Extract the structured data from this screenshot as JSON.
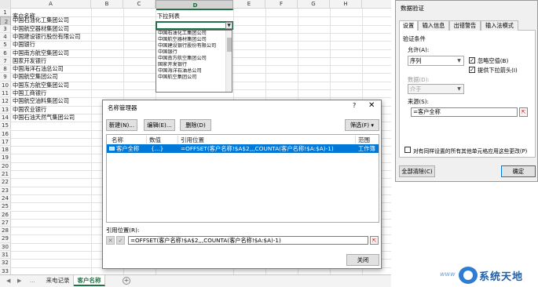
{
  "spreadsheet": {
    "columns": [
      "A",
      "B",
      "C",
      "D",
      "E",
      "F",
      "G",
      "H"
    ],
    "selected_column": "D",
    "rows": [
      "1",
      "2",
      "3",
      "4",
      "5",
      "6",
      "7",
      "8",
      "9",
      "10",
      "11",
      "12",
      "13",
      "14",
      "15",
      "16",
      "17",
      "18",
      "19",
      "20",
      "21",
      "22",
      "23",
      "24",
      "25",
      "26",
      "27",
      "28",
      "29",
      "30",
      "31",
      "32",
      "33"
    ],
    "selected_row": "2",
    "a_header": "客户名称",
    "a_values": [
      "中国石油化工集团公司",
      "中国航空器材集团公司",
      "中国建设银行股份有限公司",
      "中国银行",
      "中国南方航空集团公司",
      "国家开发银行",
      "中国海洋石油总公司",
      "中国航空集团公司",
      "中国东方航空集团公司",
      "中国工商银行",
      "中国航空油料集团公司",
      "中国农业银行",
      "中国石油天然气集团公司"
    ],
    "d_header": "下拉列表",
    "dropdown_items": [
      "中国石油化工集团公司",
      "中国航空器材集团公司",
      "中国建设银行股份有限公司",
      "中国银行",
      "中国南方航空集团公司",
      "国家开发银行",
      "中国海洋石油总公司",
      "中国航空集团公司"
    ],
    "sheet_tabs": [
      "来电记录",
      "客户名称"
    ],
    "active_tab": "客户名称",
    "nav_prev": "◀",
    "nav_next": "▶",
    "nav_more": "...",
    "add_sheet": "+"
  },
  "name_manager": {
    "title": "名称管理器",
    "help": "?",
    "close": "✕",
    "buttons": {
      "new": "新建(N)...",
      "edit": "编辑(E)...",
      "delete": "删除(D)",
      "filter": "筛选(F) ▾"
    },
    "columns": {
      "name": "名称",
      "value": "数值",
      "refers_to": "引用位置",
      "scope": "范围"
    },
    "rows": [
      {
        "name": "客户全称",
        "value": "{...}",
        "refers_to": "=OFFSET(客户名称!$A$2,,,COUNTA(客户名称!$A:$A)-1)",
        "scope": "工作簿"
      }
    ],
    "ref_label": "引用位置(R):",
    "ref_cancel": "✕",
    "ref_confirm": "✓",
    "ref_value": "=OFFSET(客户名称!$A$2,,,COUNTA(客户名称!$A:$A)-1)",
    "close_button": "关闭"
  },
  "data_validation": {
    "title": "数据验证",
    "tabs": [
      "设置",
      "输入信息",
      "出错警告",
      "输入法模式"
    ],
    "active_tab": "设置",
    "criteria_label": "验证条件",
    "allow_label": "允许(A):",
    "allow_value": "序列",
    "ignore_blank_label": "忽略空值(B)",
    "ignore_blank_checked": true,
    "dropdown_label": "提供下拉箭头(I)",
    "dropdown_checked": true,
    "data_label": "数据(D):",
    "data_value": "介于",
    "source_label": "来源(S):",
    "source_value": "=客户全称",
    "apply_all_label": "对有同样设置的所有其他单元格应用这些更改(P)",
    "apply_all_checked": false,
    "clear_all": "全部清除(C)",
    "ok": "确定"
  },
  "watermark": {
    "prefix": "www",
    "text": "系统天地"
  }
}
